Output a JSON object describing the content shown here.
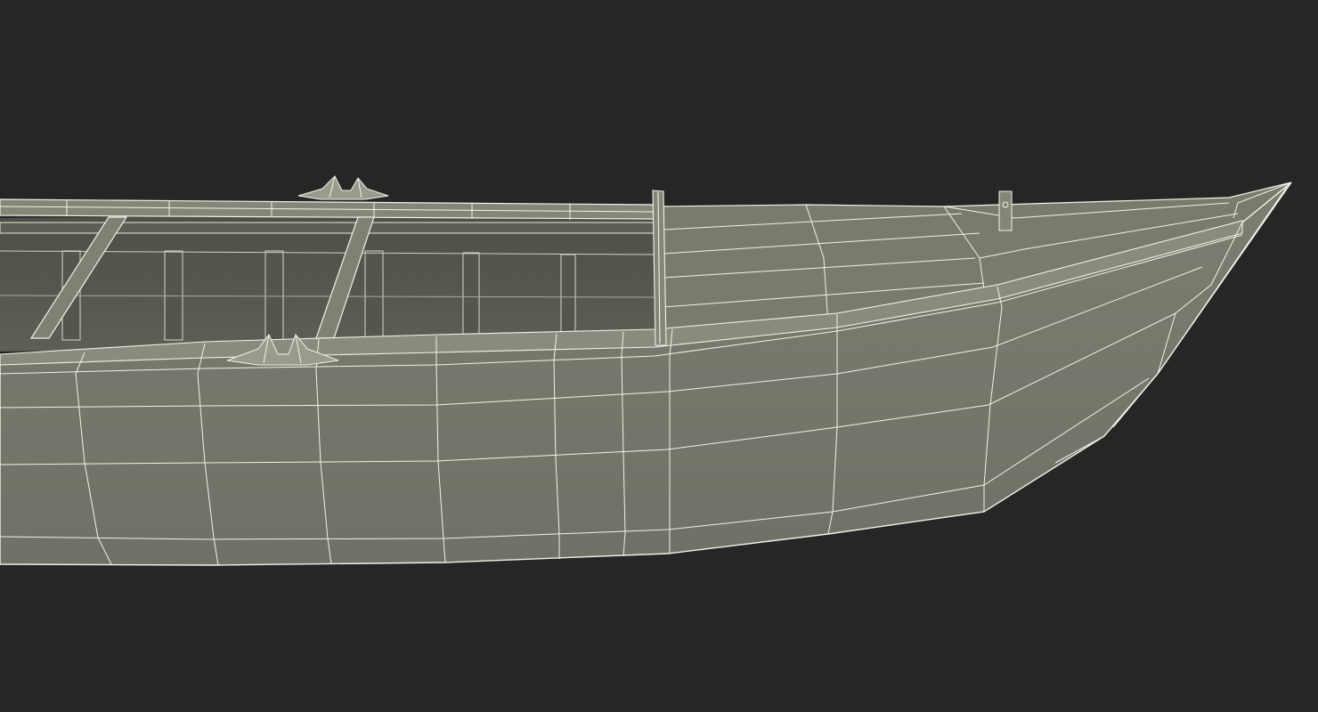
{
  "scene": {
    "subject": "boat-wireframe",
    "colors": {
      "background": "#262626",
      "hull": "#77776c",
      "hull_dark": "#65655b",
      "interior": "#5a5a52",
      "interior_dark": "#4b4b45",
      "rail": "#8a8a7e",
      "wire": "#f2f2e6"
    }
  }
}
